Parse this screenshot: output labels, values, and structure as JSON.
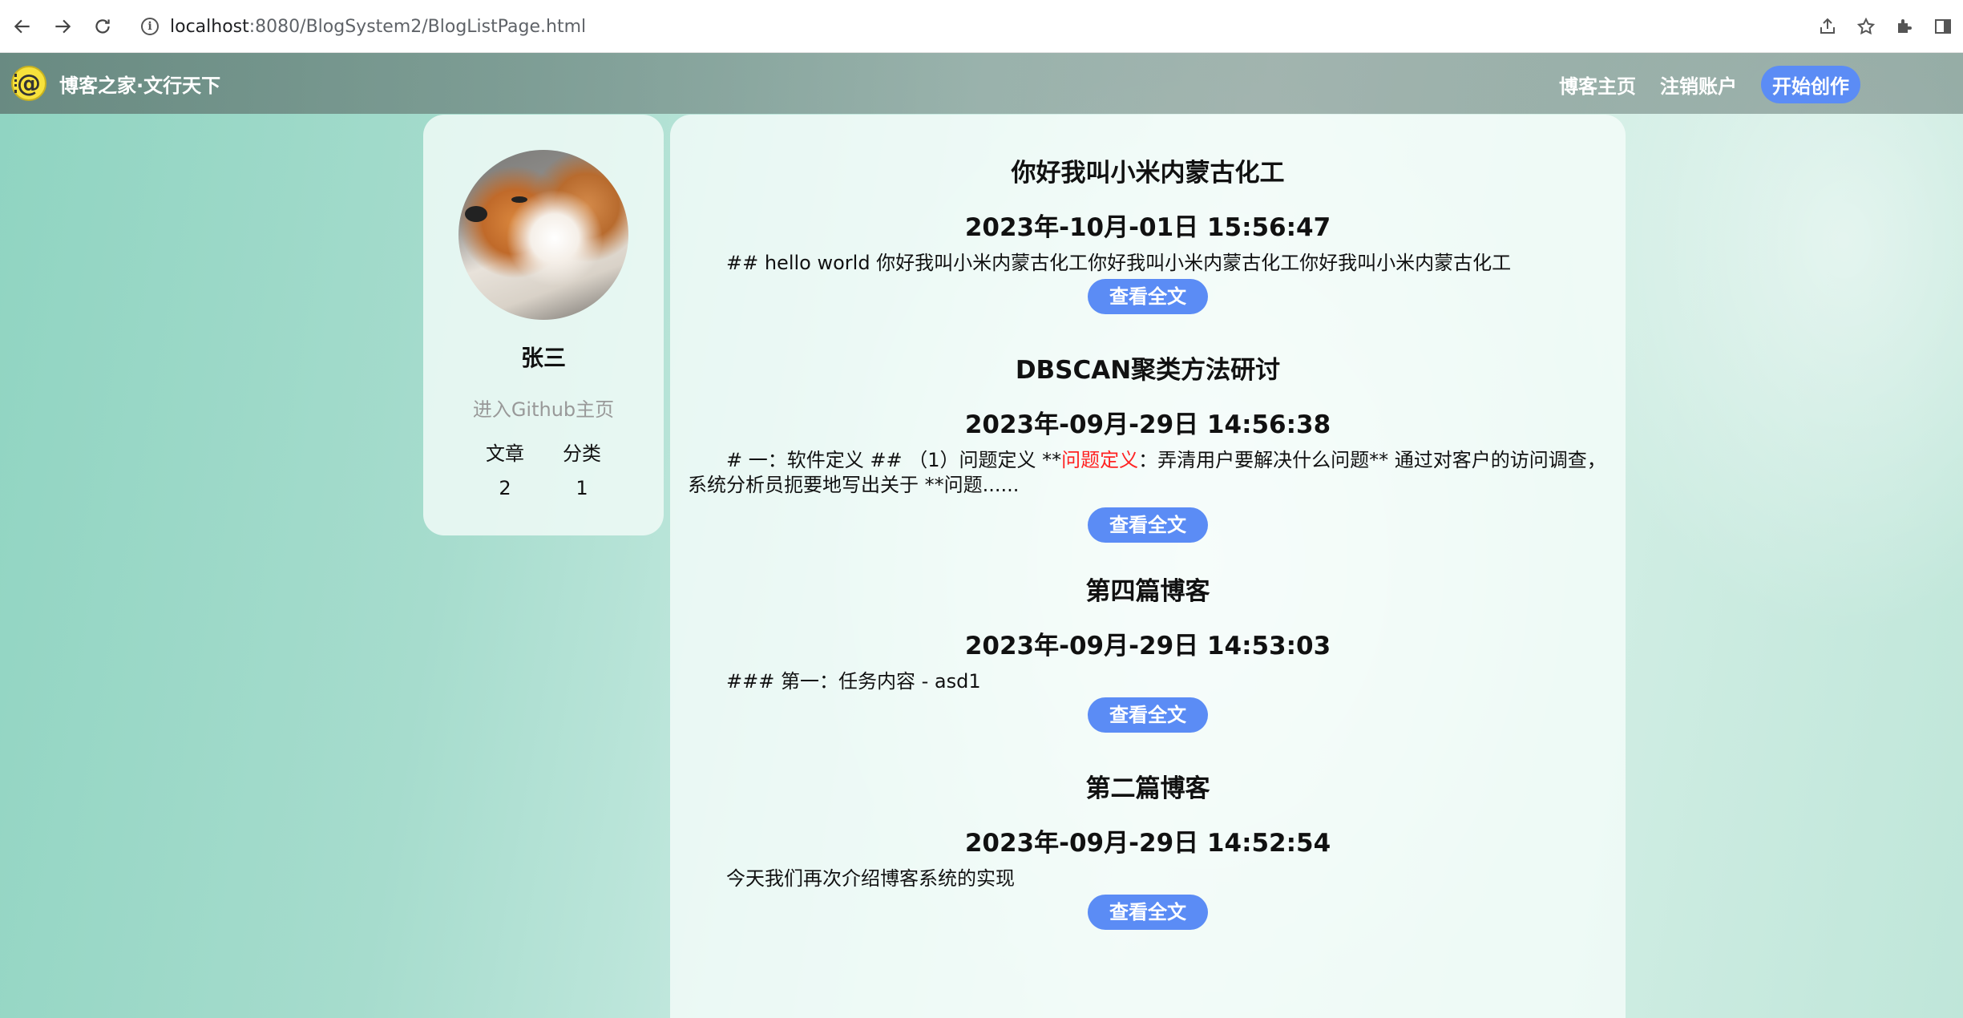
{
  "browser": {
    "url_host": "localhost",
    "url_rest": ":8080/BlogSystem2/BlogListPage.html"
  },
  "nav": {
    "site_title": "博客之家·文行天下",
    "logo_text": "@",
    "links": [
      "博客主页",
      "注销账户",
      "开始创作"
    ]
  },
  "profile": {
    "username": "张三",
    "github_link": "进入Github主页",
    "stats_labels": [
      "文章",
      "分类"
    ],
    "stats_values": [
      "2",
      "1"
    ]
  },
  "blogs": [
    {
      "title": "你好我叫小米内蒙古化工",
      "date": "2023年-10月-01日 15:56:47",
      "desc_parts": [
        "## hello world 你好我叫小米内蒙古化工你好我叫小米内蒙古化工你好我叫小米内蒙古化工"
      ],
      "button": "查看全文"
    },
    {
      "title": "DBSCAN聚类方法研讨",
      "date": "2023年-09月-29日 14:56:38",
      "desc_parts": [
        "# 一：软件定义 ## （1）问题定义 **",
        "问题定义",
        "：弄清用户要解决什么问题** 通过对客户的访问调查，系统分析员扼要地写出关于 **问题......"
      ],
      "button": "查看全文"
    },
    {
      "title": "第四篇博客",
      "date": "2023年-09月-29日 14:53:03",
      "desc_parts": [
        "### 第一：任务内容 - asd1"
      ],
      "button": "查看全文"
    },
    {
      "title": "第二篇博客",
      "date": "2023年-09月-29日 14:52:54",
      "desc_parts": [
        "今天我们再次介绍博客系统的实现"
      ],
      "button": "查看全文"
    }
  ],
  "colors": {
    "accent": "#5b8cf5",
    "highlight": "#ff2222"
  }
}
